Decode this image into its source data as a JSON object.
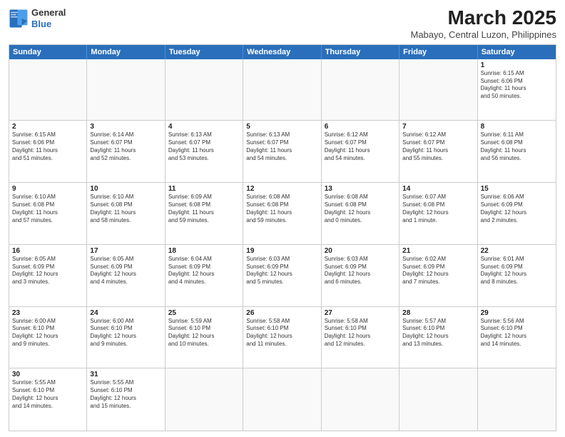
{
  "header": {
    "logo_general": "General",
    "logo_blue": "Blue",
    "title": "March 2025",
    "subtitle": "Mabayo, Central Luzon, Philippines"
  },
  "weekdays": [
    "Sunday",
    "Monday",
    "Tuesday",
    "Wednesday",
    "Thursday",
    "Friday",
    "Saturday"
  ],
  "weeks": [
    [
      {
        "day": "",
        "info": ""
      },
      {
        "day": "",
        "info": ""
      },
      {
        "day": "",
        "info": ""
      },
      {
        "day": "",
        "info": ""
      },
      {
        "day": "",
        "info": ""
      },
      {
        "day": "",
        "info": ""
      },
      {
        "day": "1",
        "info": "Sunrise: 6:15 AM\nSunset: 6:06 PM\nDaylight: 11 hours\nand 50 minutes."
      }
    ],
    [
      {
        "day": "2",
        "info": "Sunrise: 6:15 AM\nSunset: 6:06 PM\nDaylight: 11 hours\nand 51 minutes."
      },
      {
        "day": "3",
        "info": "Sunrise: 6:14 AM\nSunset: 6:07 PM\nDaylight: 11 hours\nand 52 minutes."
      },
      {
        "day": "4",
        "info": "Sunrise: 6:13 AM\nSunset: 6:07 PM\nDaylight: 11 hours\nand 53 minutes."
      },
      {
        "day": "5",
        "info": "Sunrise: 6:13 AM\nSunset: 6:07 PM\nDaylight: 11 hours\nand 54 minutes."
      },
      {
        "day": "6",
        "info": "Sunrise: 6:12 AM\nSunset: 6:07 PM\nDaylight: 11 hours\nand 54 minutes."
      },
      {
        "day": "7",
        "info": "Sunrise: 6:12 AM\nSunset: 6:07 PM\nDaylight: 11 hours\nand 55 minutes."
      },
      {
        "day": "8",
        "info": "Sunrise: 6:11 AM\nSunset: 6:08 PM\nDaylight: 11 hours\nand 56 minutes."
      }
    ],
    [
      {
        "day": "9",
        "info": "Sunrise: 6:10 AM\nSunset: 6:08 PM\nDaylight: 11 hours\nand 57 minutes."
      },
      {
        "day": "10",
        "info": "Sunrise: 6:10 AM\nSunset: 6:08 PM\nDaylight: 11 hours\nand 58 minutes."
      },
      {
        "day": "11",
        "info": "Sunrise: 6:09 AM\nSunset: 6:08 PM\nDaylight: 11 hours\nand 59 minutes."
      },
      {
        "day": "12",
        "info": "Sunrise: 6:08 AM\nSunset: 6:08 PM\nDaylight: 11 hours\nand 59 minutes."
      },
      {
        "day": "13",
        "info": "Sunrise: 6:08 AM\nSunset: 6:08 PM\nDaylight: 12 hours\nand 0 minutes."
      },
      {
        "day": "14",
        "info": "Sunrise: 6:07 AM\nSunset: 6:08 PM\nDaylight: 12 hours\nand 1 minute."
      },
      {
        "day": "15",
        "info": "Sunrise: 6:06 AM\nSunset: 6:09 PM\nDaylight: 12 hours\nand 2 minutes."
      }
    ],
    [
      {
        "day": "16",
        "info": "Sunrise: 6:05 AM\nSunset: 6:09 PM\nDaylight: 12 hours\nand 3 minutes."
      },
      {
        "day": "17",
        "info": "Sunrise: 6:05 AM\nSunset: 6:09 PM\nDaylight: 12 hours\nand 4 minutes."
      },
      {
        "day": "18",
        "info": "Sunrise: 6:04 AM\nSunset: 6:09 PM\nDaylight: 12 hours\nand 4 minutes."
      },
      {
        "day": "19",
        "info": "Sunrise: 6:03 AM\nSunset: 6:09 PM\nDaylight: 12 hours\nand 5 minutes."
      },
      {
        "day": "20",
        "info": "Sunrise: 6:03 AM\nSunset: 6:09 PM\nDaylight: 12 hours\nand 6 minutes."
      },
      {
        "day": "21",
        "info": "Sunrise: 6:02 AM\nSunset: 6:09 PM\nDaylight: 12 hours\nand 7 minutes."
      },
      {
        "day": "22",
        "info": "Sunrise: 6:01 AM\nSunset: 6:09 PM\nDaylight: 12 hours\nand 8 minutes."
      }
    ],
    [
      {
        "day": "23",
        "info": "Sunrise: 6:00 AM\nSunset: 6:10 PM\nDaylight: 12 hours\nand 9 minutes."
      },
      {
        "day": "24",
        "info": "Sunrise: 6:00 AM\nSunset: 6:10 PM\nDaylight: 12 hours\nand 9 minutes."
      },
      {
        "day": "25",
        "info": "Sunrise: 5:59 AM\nSunset: 6:10 PM\nDaylight: 12 hours\nand 10 minutes."
      },
      {
        "day": "26",
        "info": "Sunrise: 5:58 AM\nSunset: 6:10 PM\nDaylight: 12 hours\nand 11 minutes."
      },
      {
        "day": "27",
        "info": "Sunrise: 5:58 AM\nSunset: 6:10 PM\nDaylight: 12 hours\nand 12 minutes."
      },
      {
        "day": "28",
        "info": "Sunrise: 5:57 AM\nSunset: 6:10 PM\nDaylight: 12 hours\nand 13 minutes."
      },
      {
        "day": "29",
        "info": "Sunrise: 5:56 AM\nSunset: 6:10 PM\nDaylight: 12 hours\nand 14 minutes."
      }
    ],
    [
      {
        "day": "30",
        "info": "Sunrise: 5:55 AM\nSunset: 6:10 PM\nDaylight: 12 hours\nand 14 minutes."
      },
      {
        "day": "31",
        "info": "Sunrise: 5:55 AM\nSunset: 6:10 PM\nDaylight: 12 hours\nand 15 minutes."
      },
      {
        "day": "",
        "info": ""
      },
      {
        "day": "",
        "info": ""
      },
      {
        "day": "",
        "info": ""
      },
      {
        "day": "",
        "info": ""
      },
      {
        "day": "",
        "info": ""
      }
    ]
  ]
}
